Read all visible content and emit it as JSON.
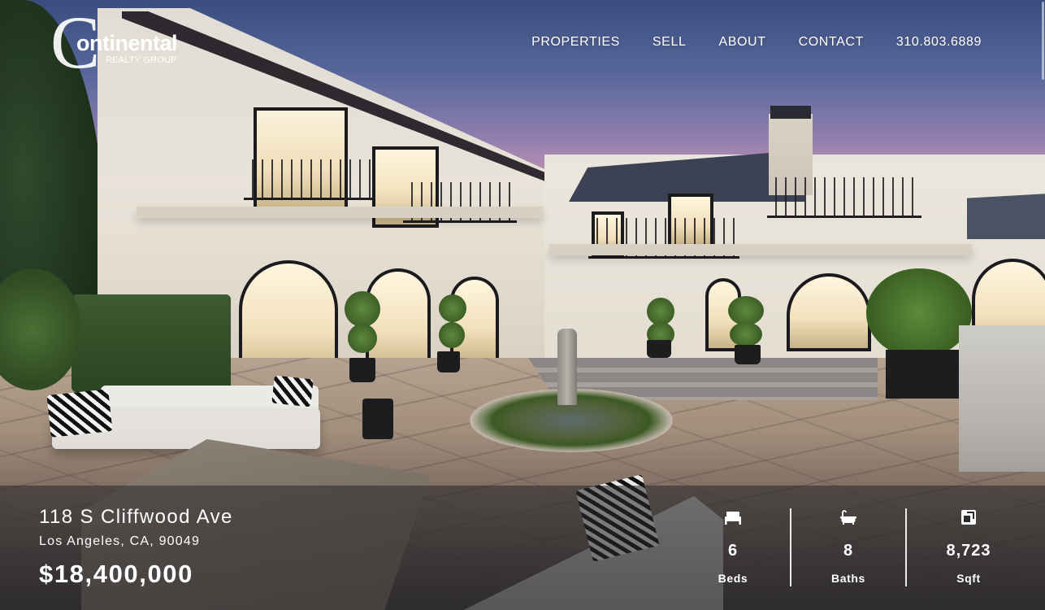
{
  "brand": {
    "logo_letter": "C",
    "logo_word": "ontinental",
    "logo_sub": "REALTY GROUP"
  },
  "nav": {
    "items": [
      {
        "label": "PROPERTIES"
      },
      {
        "label": "SELL"
      },
      {
        "label": "ABOUT"
      },
      {
        "label": "CONTACT"
      },
      {
        "label": "310.803.6889"
      }
    ]
  },
  "listing": {
    "address": "118 S Cliffwood Ave",
    "city": "Los Angeles, CA, 90049",
    "price": "$18,400,000",
    "stats": [
      {
        "icon": "bed-icon",
        "value": "6",
        "label": "Beds"
      },
      {
        "icon": "bathtub-icon",
        "value": "8",
        "label": "Baths"
      },
      {
        "icon": "square-footage-icon",
        "value": "8,723",
        "label": "Sqft"
      }
    ]
  },
  "colors": {
    "info_bar_overlay": "#28282c",
    "text": "#ffffff"
  }
}
